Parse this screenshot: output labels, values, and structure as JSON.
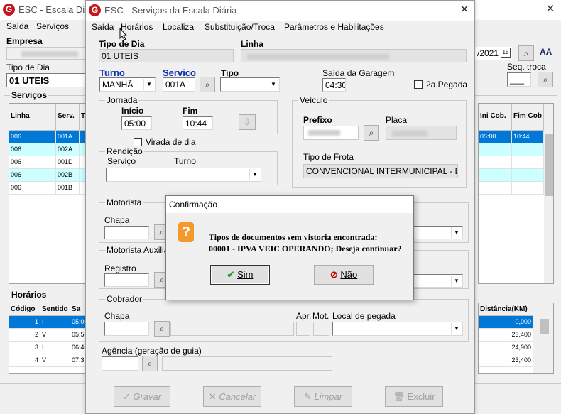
{
  "bg": {
    "title": "ESC - Escala Diária",
    "menu": [
      "Saída",
      "Serviços"
    ],
    "empresa_label": "Empresa",
    "tipo_dia_label": "Tipo de Dia",
    "tipo_dia_value": "01 UTEIS",
    "date_value": "/2021",
    "seq_troca_label": "Seq. troca",
    "seq_troca_value": "___",
    "servicos_label": "Serviços",
    "servicos_columns": [
      "Linha",
      "Serv.",
      "Tu",
      "Ini Cob.",
      "Fim Cob"
    ],
    "servicos_rows": [
      {
        "linha": "006",
        "serv": "001A",
        "ini": "05:00",
        "fim": "10:44"
      },
      {
        "linha": "006",
        "serv": "002A",
        "ini": "",
        "fim": ""
      },
      {
        "linha": "006",
        "serv": "001D",
        "ini": "",
        "fim": ""
      },
      {
        "linha": "006",
        "serv": "002B",
        "ini": "",
        "fim": ""
      },
      {
        "linha": "006",
        "serv": "001B",
        "ini": "",
        "fim": ""
      }
    ],
    "horarios_label": "Horários",
    "horarios_columns": [
      "Código",
      "Sentido",
      "Sa",
      "Distância(KM)"
    ],
    "horarios_rows": [
      {
        "codigo": "1",
        "sentido": "I",
        "sa": "05:00",
        "dist": "0,000"
      },
      {
        "codigo": "2",
        "sentido": "V",
        "sa": "05:50",
        "dist": "23,400"
      },
      {
        "codigo": "3",
        "sentido": "I",
        "sa": "06:40",
        "dist": "24,900"
      },
      {
        "codigo": "4",
        "sentido": "V",
        "sa": "07:35",
        "dist": "23,400"
      }
    ]
  },
  "dlg": {
    "title": "ESC - Serviços da Escala Diária",
    "menu": [
      "Saída",
      "Horários",
      "Localiza",
      "Substituição/Troca",
      "Parâmetros e Habilitações"
    ],
    "tipo_dia_label": "Tipo de Dia",
    "tipo_dia_value": "01 UTEIS",
    "linha_label": "Linha",
    "turno_label": "Turno",
    "turno_value": "MANHÃ",
    "servico_label": "Servico",
    "servico_value": "001A",
    "tipo_label": "Tipo",
    "saida_garagem_label": "Saída da Garagem",
    "saida_garagem_value": "04:30",
    "pegada_label": "2a.Pegada",
    "jornada_label": "Jornada",
    "inicio_label": "Início",
    "inicio_value": "05:00",
    "fim_label": "Fim",
    "fim_value": "10:44",
    "virada_label": "Virada de dia",
    "veiculo_label": "Veículo",
    "prefixo_label": "Prefixo",
    "placa_label": "Placa",
    "tipo_frota_label": "Tipo de Frota",
    "tipo_frota_value": "CONVENCIONAL INTERMUNICIPAL - DIAD",
    "rendicao_label": "Rendição",
    "rend_servico_label": "Serviço",
    "rend_turno_label": "Turno",
    "motorista_label": "Motorista",
    "chapa_label": "Chapa",
    "motorista_aux_label": "Motorista Auxiliar",
    "registro_label": "Registro",
    "cobrador_label": "Cobrador",
    "cobrador_chapa_label": "Chapa",
    "apr_label": "Apr.",
    "mot_label": "Mot.",
    "local_pegada_label": "Local de pegada",
    "agencia_label": "Agência (geração de guia)",
    "buttons": {
      "gravar": "Gravar",
      "cancelar": "Cancelar",
      "limpar": "Limpar",
      "excluir": "Excluir"
    }
  },
  "confirm": {
    "title": "Confirmação",
    "line1": "Tipos de documentos sem vistoria encontrada:",
    "line2": "00001 - IPVA VEIC OPERANDO; Deseja continuar?",
    "sim": "Sim",
    "nao": "Não"
  }
}
